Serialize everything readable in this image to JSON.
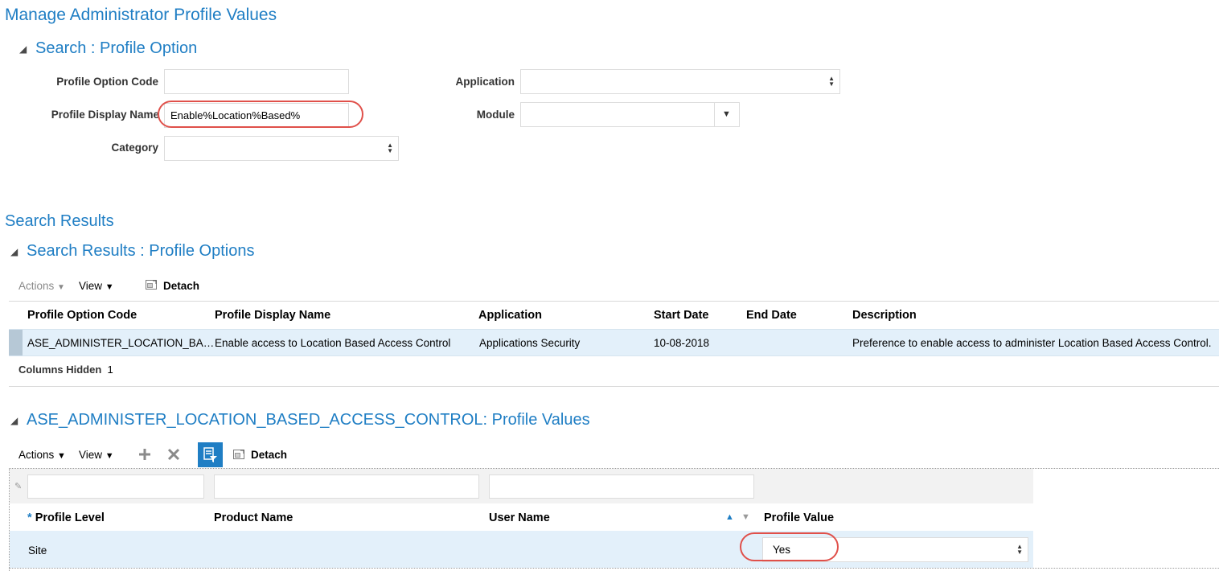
{
  "page": {
    "title": "Manage Administrator Profile Values"
  },
  "search": {
    "heading": "Search : Profile Option",
    "profile_option_code_label": "Profile Option Code",
    "profile_option_code_value": "",
    "profile_display_name_label": "Profile Display Name",
    "profile_display_name_value": "Enable%Location%Based%",
    "category_label": "Category",
    "category_value": "",
    "application_label": "Application",
    "application_value": "",
    "module_label": "Module",
    "module_value": ""
  },
  "results": {
    "section_title": "Search Results",
    "heading": "Search Results : Profile Options",
    "toolbar": {
      "actions": "Actions",
      "view": "View",
      "detach": "Detach"
    },
    "columns": [
      "Profile Option Code",
      "Profile Display Name",
      "Application",
      "Start Date",
      "End Date",
      "Description"
    ],
    "rows": [
      {
        "code": "ASE_ADMINISTER_LOCATION_BA…",
        "display_name": "Enable access to Location Based Access Control",
        "application": "Applications Security",
        "start_date": "10-08-2018",
        "end_date": "",
        "description": "Preference to enable access to administer Location Based Access Control."
      }
    ],
    "columns_hidden_label": "Columns Hidden",
    "columns_hidden_count": "1"
  },
  "values": {
    "heading": "ASE_ADMINISTER_LOCATION_BASED_ACCESS_CONTROL: Profile Values",
    "toolbar": {
      "actions": "Actions",
      "view": "View",
      "detach": "Detach"
    },
    "columns": {
      "required_mark": "*",
      "profile_level": "Profile Level",
      "product_name": "Product Name",
      "user_name": "User Name",
      "profile_value": "Profile Value"
    },
    "rows": [
      {
        "profile_level": "Site",
        "product_name": "",
        "user_name": "",
        "profile_value": "Yes"
      }
    ]
  },
  "colors": {
    "accent": "#1f7ec4",
    "selected_row": "#e3f0fa",
    "annotation": "#e0504a"
  }
}
